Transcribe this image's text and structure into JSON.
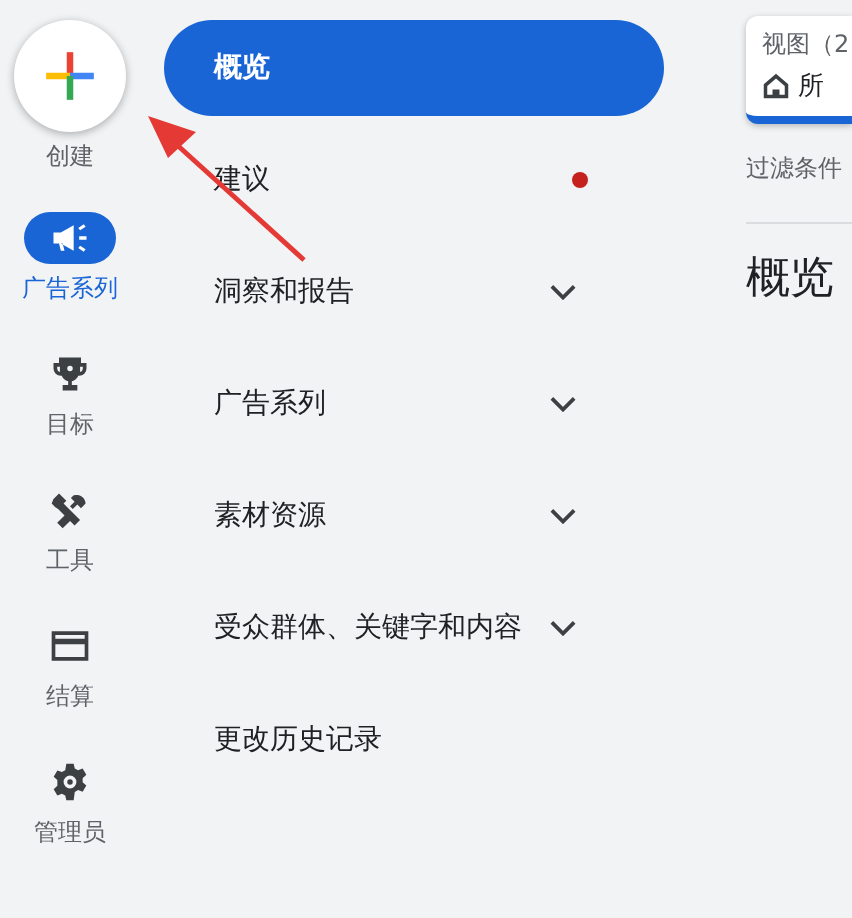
{
  "rail": {
    "create": {
      "label": "创建"
    },
    "items": [
      {
        "kind": "megaphone",
        "label": "广告系列",
        "selected": true
      },
      {
        "kind": "trophy",
        "label": "目标",
        "selected": false
      },
      {
        "kind": "tools",
        "label": "工具",
        "selected": false
      },
      {
        "kind": "card",
        "label": "结算",
        "selected": false
      },
      {
        "kind": "gear",
        "label": "管理员",
        "selected": false
      }
    ]
  },
  "nav": {
    "items": [
      {
        "kind": "link",
        "label": "概览",
        "selected": true
      },
      {
        "kind": "alert",
        "label": "建议",
        "selected": false
      },
      {
        "kind": "expandable",
        "label": "洞察和报告",
        "selected": false
      },
      {
        "kind": "expandable",
        "label": "广告系列",
        "selected": false
      },
      {
        "kind": "expandable",
        "label": "素材资源",
        "selected": false
      },
      {
        "kind": "expandable",
        "label": "受众群体、关键字和内容",
        "selected": false
      },
      {
        "kind": "link",
        "label": "更改历史记录",
        "selected": false
      }
    ]
  },
  "content": {
    "view_tab": {
      "label": "视图（2",
      "value": "所"
    },
    "filter_label": "过滤条件",
    "heading": "概览"
  }
}
